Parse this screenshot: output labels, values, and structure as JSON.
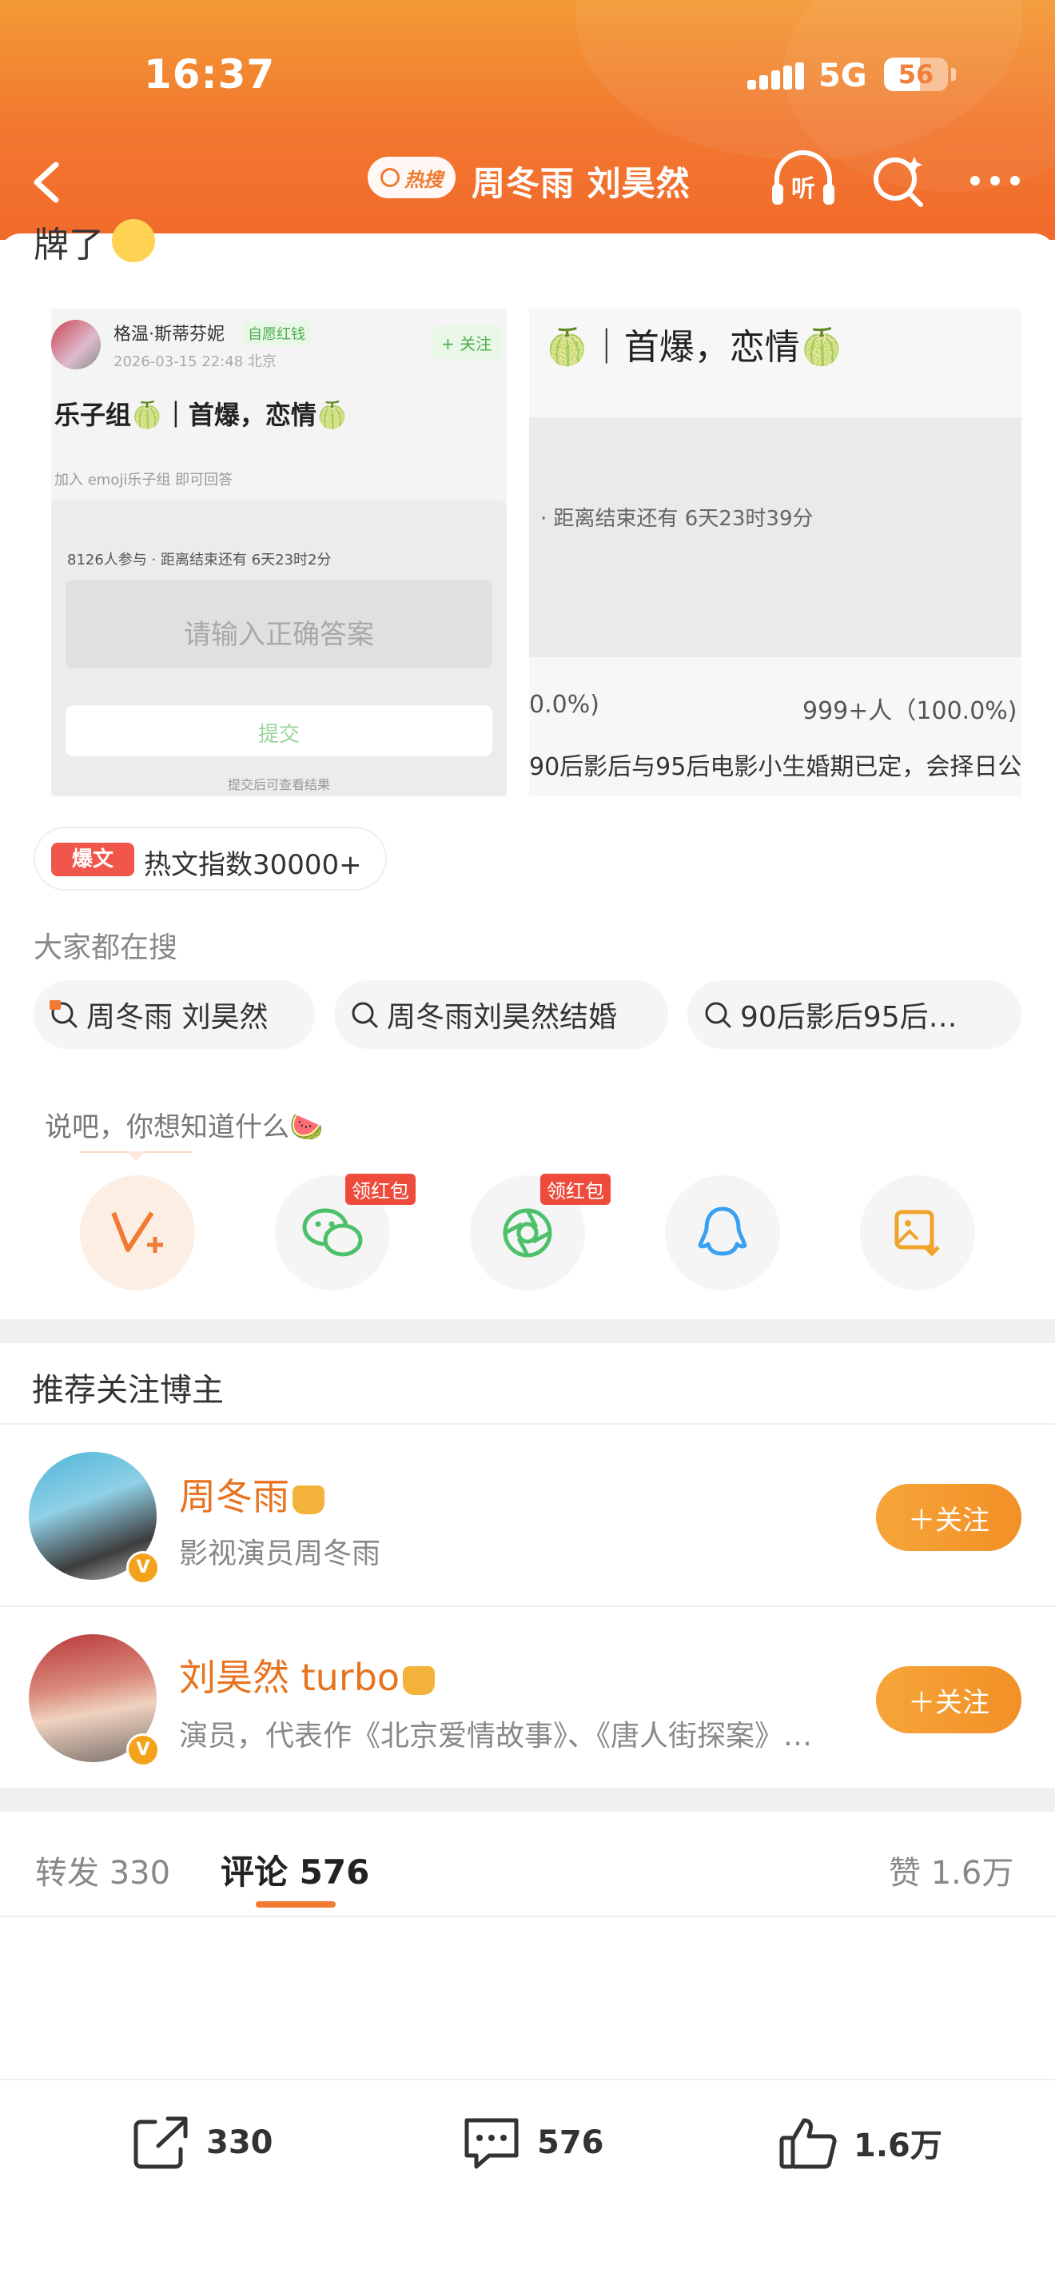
{
  "status_bar": {
    "time": "16:37",
    "network": "5G",
    "battery": "56",
    "battery_fraction": 0.56
  },
  "nav": {
    "hot_badge": "热搜",
    "title": "周冬雨 刘昊然"
  },
  "post": {
    "cut_text": "牌了",
    "embedded_left": {
      "author": "格温·斯蒂芬妮",
      "author_tag": "自愿红钱",
      "time": "2026-03-15 22:48 北京",
      "follow": "+ 关注",
      "title": "乐子组🍈｜首爆，恋情🍈",
      "join_hint": "加入 emoji乐子组 即可回答",
      "participants": "8126人参与 · 距离结束还有 6天23时2分",
      "input_placeholder": "请输入正确答案",
      "submit": "提交",
      "note": "提交后可查看结果"
    },
    "embedded_right": {
      "title": "🍈｜首爆，恋情🍈",
      "countdown": "· 距离结束还有 6天23时39分",
      "pct_left": "0.0%)",
      "pct_right": "999+人（100.0%)",
      "bottom": "90后影后与95后电影小生婚期已定，会择日公"
    },
    "hot_index": {
      "tag": "爆文",
      "text": "热文指数30000+"
    }
  },
  "search_section": {
    "title": "大家都在搜",
    "chips": [
      {
        "label": "周冬雨 刘昊然"
      },
      {
        "label": "周冬雨刘昊然结婚"
      },
      {
        "label": "90后影后95后…"
      }
    ]
  },
  "share": {
    "prompt": "说吧，你想知道什么🍉",
    "red_packet": "领红包",
    "items": [
      {
        "icon": "weibo-v-plus-icon"
      },
      {
        "icon": "wechat-icon"
      },
      {
        "icon": "moments-icon"
      },
      {
        "icon": "qq-icon"
      },
      {
        "icon": "save-image-icon"
      }
    ]
  },
  "recommend": {
    "title": "推荐关注博主",
    "follow_label": "＋关注",
    "bloggers": [
      {
        "name": "周冬雨",
        "desc": "影视演员周冬雨"
      },
      {
        "name": "刘昊然 turbo",
        "desc": "演员，代表作《北京爱情故事》、《唐人街探案》…"
      }
    ]
  },
  "tabs": {
    "repost": "转发 330",
    "comment": "评论 576",
    "like": "赞 1.6万"
  },
  "bottom_bar": {
    "repost_count": "330",
    "comment_count": "576",
    "like_count": "1.6万"
  },
  "colors": {
    "header": "#f2772f",
    "accent": "#e8731f",
    "follow_button": "#f29027"
  }
}
